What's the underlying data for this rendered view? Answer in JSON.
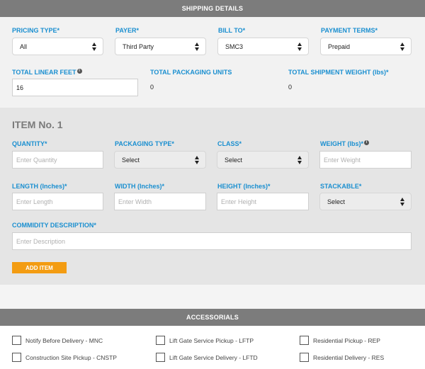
{
  "shipping": {
    "header": "SHIPPING DETAILS",
    "pricing_type": {
      "label": "PRICING TYPE*",
      "value": "All"
    },
    "payer": {
      "label": "PAYER*",
      "value": "Third Party"
    },
    "bill_to": {
      "label": "BILL TO*",
      "value": "SMC3"
    },
    "payment_terms": {
      "label": "PAYMENT TERMS*",
      "value": "Prepaid"
    },
    "total_linear_feet": {
      "label": "TOTAL LINEAR FEET",
      "value": "16"
    },
    "total_packaging_units": {
      "label": "TOTAL PACKAGING UNITS",
      "value": "0"
    },
    "total_shipment_weight": {
      "label": "TOTAL SHIPMENT WEIGHT (lbs)*",
      "value": "0"
    }
  },
  "item": {
    "title": "ITEM No. 1",
    "quantity": {
      "label": "QUANTITY*",
      "placeholder": "Enter Quantity"
    },
    "packaging_type": {
      "label": "PACKAGING TYPE*",
      "value": "Select"
    },
    "class": {
      "label": "CLASS*",
      "value": "Select"
    },
    "weight": {
      "label": "WEIGHT (lbs)*",
      "placeholder": "Enter Weight"
    },
    "length": {
      "label": "LENGTH (Inches)*",
      "placeholder": "Enter Length"
    },
    "width": {
      "label": "WIDTH (Inches)*",
      "placeholder": "Enter Width"
    },
    "height": {
      "label": "HEIGHT (Inches)*",
      "placeholder": "Enter Height"
    },
    "stackable": {
      "label": "STACKABLE*",
      "value": "Select"
    },
    "description": {
      "label": "COMMIDITY DESCRIPTION*",
      "placeholder": "Enter Description"
    },
    "add_item_label": "ADD ITEM"
  },
  "accessorials": {
    "header": "ACCESSORIALS",
    "items": [
      "Notify Before Delivery - MNC",
      "Lift Gate Service Pickup - LFTP",
      "Residential Pickup - REP",
      "Construction Site Pickup - CNSTP",
      "Lift Gate Service Delivery - LFTD",
      "Residential Delivery - RES"
    ]
  },
  "info_glyph": "i",
  "colors": {
    "header_bg": "#7c7c7c",
    "label": "#1a8fd0",
    "button": "#f39c12"
  }
}
